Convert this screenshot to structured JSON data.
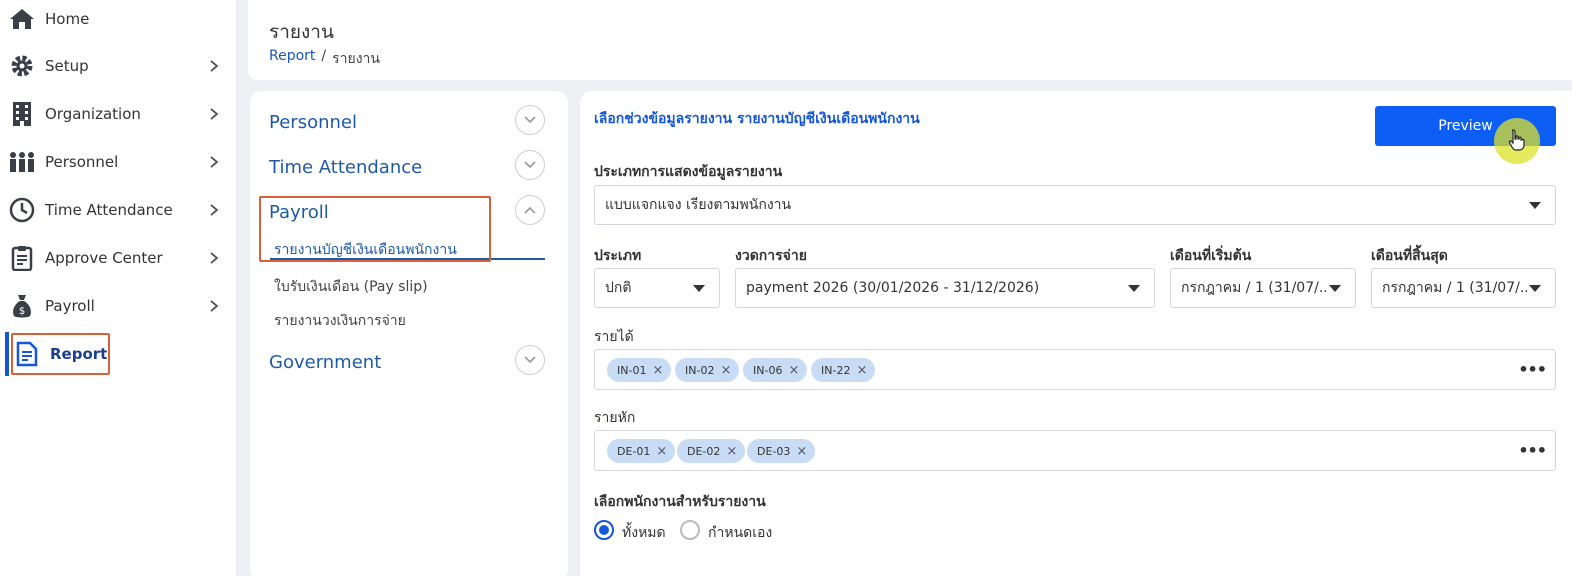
{
  "sidebar": {
    "items": [
      {
        "label": "Home",
        "icon": "home-icon"
      },
      {
        "label": "Setup",
        "icon": "gear-icon"
      },
      {
        "label": "Organization",
        "icon": "building-icon"
      },
      {
        "label": "Personnel",
        "icon": "people-icon"
      },
      {
        "label": "Time Attendance",
        "icon": "clock-icon"
      },
      {
        "label": "Approve Center",
        "icon": "clipboard-icon"
      },
      {
        "label": "Payroll",
        "icon": "money-bag-icon"
      },
      {
        "label": "Report",
        "icon": "report-icon"
      }
    ],
    "active": "Report"
  },
  "header": {
    "title": "รายงาน",
    "breadcrumb": {
      "link": "Report",
      "separator": "/",
      "current": "รายงาน"
    }
  },
  "categories": {
    "personnel": "Personnel",
    "time_attendance": "Time Attendance",
    "payroll": "Payroll",
    "payroll_items": [
      "รายงานบัญชีเงินเดือนพนักงาน",
      "ใบรับเงินเดือน (Pay slip)",
      "รายงานวงเงินการจ่าย"
    ],
    "government": "Government"
  },
  "form": {
    "section_title": "เลือกช่วงข้อมูลรายงาน รายงานบัญชีเงินเดือนพนักงาน",
    "preview_label": "Preview",
    "display_type": {
      "label": "ประเภทการแสดงข้อมูลรายงาน",
      "value": "แบบแจกแจง เรียงตามพนักงาน"
    },
    "type": {
      "label": "ประเภท",
      "value": "ปกติ"
    },
    "payment_period": {
      "label": "งวดการจ่าย",
      "value": "payment 2026 (30/01/2026 - 31/12/2026)"
    },
    "start_month": {
      "label": "เดือนที่เริ่มต้น",
      "value": "กรกฎาคม / 1 (31/07/..."
    },
    "end_month": {
      "label": "เดือนที่สิ้นสุด",
      "value": "กรกฎาคม / 1 (31/07/..."
    },
    "income": {
      "label": "รายได้",
      "tags": [
        "IN-01",
        "IN-02",
        "IN-06",
        "IN-22"
      ]
    },
    "deduction": {
      "label": "รายหัก",
      "tags": [
        "DE-01",
        "DE-02",
        "DE-03"
      ]
    },
    "employee_select": {
      "label": "เลือกพนักงานสำหรับรายงาน",
      "options": [
        "ทั้งหมด",
        "กำหนดเอง"
      ],
      "selected": "ทั้งหมด"
    }
  },
  "colors": {
    "accent": "#1557d6",
    "button": "#0d5ef5",
    "highlight": "#d9603b",
    "tag": "#c9dcf6"
  }
}
